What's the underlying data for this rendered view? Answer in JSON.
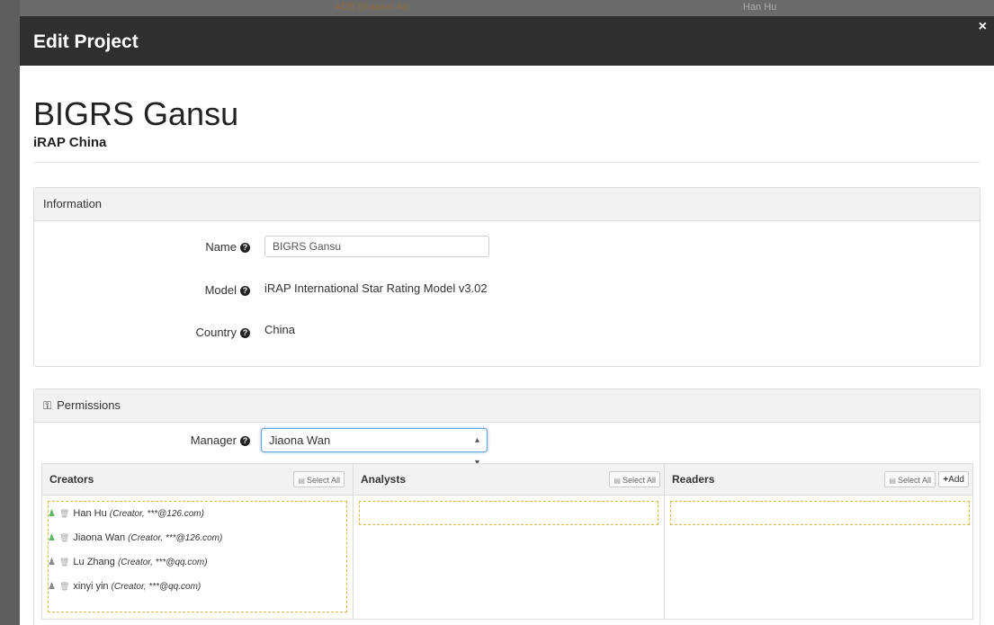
{
  "backdrop": {
    "text_left": "ADB Shaanxi Ad",
    "text_right": "Han Hu"
  },
  "modal": {
    "title": "Edit Project",
    "close_label": "×"
  },
  "project": {
    "name": "BIGRS Gansu",
    "organization": "iRAP China"
  },
  "information": {
    "heading": "Information",
    "name_label": "Name",
    "name_value": "BIGRS Gansu",
    "model_label": "Model",
    "model_value": "iRAP International Star Rating Model v3.02",
    "country_label": "Country",
    "country_value": "China"
  },
  "permissions": {
    "heading": "Permissions",
    "manager_label": "Manager",
    "manager_value": "Jiaona Wan",
    "select_all_label": "Select All",
    "add_label": "Add",
    "creators": {
      "title": "Creators",
      "members": [
        {
          "name": "Han Hu",
          "meta": "(Creator, ***@126.com)",
          "status": "active"
        },
        {
          "name": "Jiaona Wan",
          "meta": "(Creator, ***@126.com)",
          "status": "active"
        },
        {
          "name": "Lu Zhang",
          "meta": "(Creator, ***@qq.com)",
          "status": "inactive"
        },
        {
          "name": "xinyi yin",
          "meta": "(Creator, ***@qq.com)",
          "status": "inactive"
        }
      ]
    },
    "analysts": {
      "title": "Analysts"
    },
    "readers": {
      "title": "Readers"
    }
  },
  "colors": {
    "header_bg": "#2f2f2f",
    "active_user": "#5cb85c",
    "inactive_user": "#888888",
    "dropzone_border": "#e0b84c"
  }
}
